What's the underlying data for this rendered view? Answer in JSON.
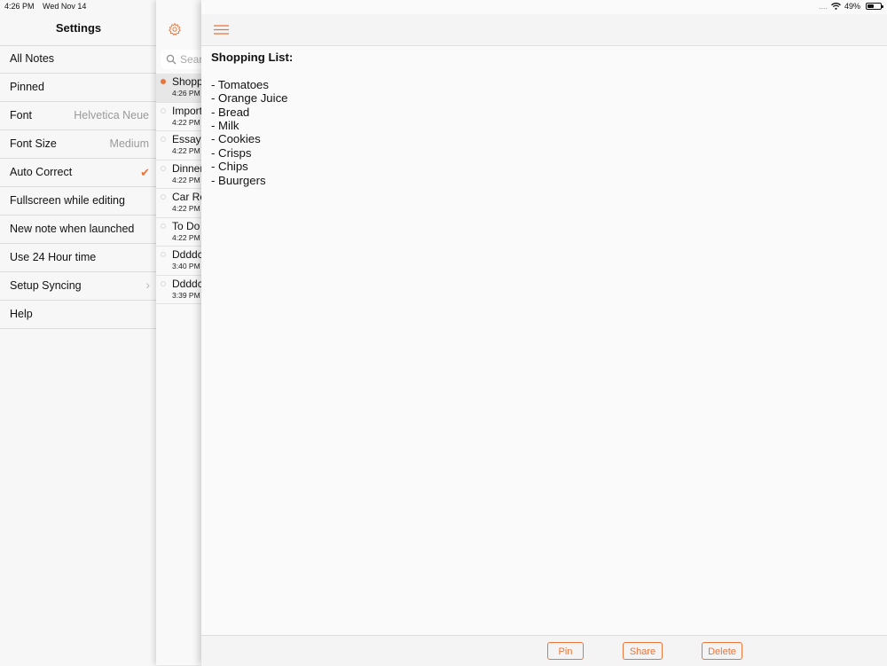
{
  "status_bar": {
    "time": "4:26 PM",
    "date": "Wed Nov 14",
    "signal": "....",
    "battery": "49%",
    "battery_level": 0.49
  },
  "settings": {
    "title": "Settings",
    "items": [
      {
        "label": "All Notes",
        "value": "",
        "accessory": ""
      },
      {
        "label": "Pinned",
        "value": "",
        "accessory": ""
      },
      {
        "label": "Font",
        "value": "Helvetica Neue",
        "accessory": ""
      },
      {
        "label": "Font Size",
        "value": "Medium",
        "accessory": ""
      },
      {
        "label": "Auto Correct",
        "value": "",
        "accessory": "checkmark-icon"
      },
      {
        "label": "Fullscreen while editing",
        "value": "",
        "accessory": ""
      },
      {
        "label": "New note when launched",
        "value": "",
        "accessory": ""
      },
      {
        "label": "Use 24 Hour time",
        "value": "",
        "accessory": ""
      },
      {
        "label": "Setup Syncing",
        "value": "",
        "accessory": "chevron-right-icon"
      },
      {
        "label": "Help",
        "value": "",
        "accessory": ""
      }
    ]
  },
  "notes_list": {
    "search_placeholder": "Sear",
    "items": [
      {
        "title": "Shopp",
        "time": "4:26 PM",
        "selected": true
      },
      {
        "title": "Import",
        "time": "4:22 PM",
        "selected": false
      },
      {
        "title": "Essay",
        "time": "4:22 PM",
        "selected": false
      },
      {
        "title": "Dinner",
        "time": "4:22 PM",
        "selected": false
      },
      {
        "title": "Car Re",
        "time": "4:22 PM",
        "selected": false
      },
      {
        "title": "To Do",
        "time": "4:22 PM",
        "selected": false
      },
      {
        "title": "Ddddc",
        "time": "3:40 PM",
        "selected": false
      },
      {
        "title": "Ddddc",
        "time": "3:39 PM",
        "selected": false
      }
    ]
  },
  "editor": {
    "heading": "Shopping List:",
    "lines": [
      "- Tomatoes",
      "- Orange Juice",
      "- Bread",
      "- Milk",
      "- Cookies",
      "- Crisps",
      "- Chips",
      "- Buurgers"
    ]
  },
  "footer": {
    "pin_label": "Pin",
    "share_label": "Share",
    "delete_label": "Delete"
  },
  "colors": {
    "accent": "#e8753a",
    "background": "#f7f7f7",
    "divider": "#dcdcdc"
  }
}
